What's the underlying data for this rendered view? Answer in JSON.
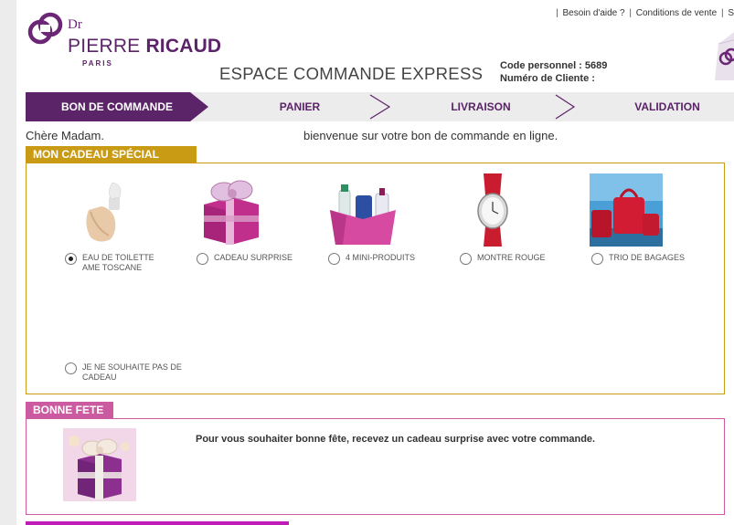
{
  "top_links": {
    "help": "Besoin d'aide ?",
    "terms": "Conditions de vente",
    "more": "S"
  },
  "logo": {
    "dr": "Dr",
    "first": "PIERRE",
    "last": "RICAUD",
    "city": "PARIS"
  },
  "header": {
    "title": "ESPACE COMMANDE EXPRESS",
    "code_label": "Code personnel :",
    "code_value": "5689",
    "client_label": "Numéro de Cliente :",
    "client_value": ""
  },
  "steps": [
    {
      "label": "BON DE COMMANDE",
      "active": true
    },
    {
      "label": "PANIER",
      "active": false
    },
    {
      "label": "LIVRAISON",
      "active": false
    },
    {
      "label": "VALIDATION",
      "active": false
    }
  ],
  "greeting": {
    "salutation": "Chère Madam.",
    "welcome": "bienvenue sur votre bon de commande en ligne."
  },
  "gift_section": {
    "title": "MON CADEAU SPÉCIAL FÊTES",
    "options": [
      {
        "label": "EAU DE TOILETTE AME TOSCANE",
        "selected": true,
        "icon": "perfume-bottle-image"
      },
      {
        "label": "CADEAU SURPRISE",
        "selected": false,
        "icon": "gift-box-image"
      },
      {
        "label": "4 MINI-PRODUITS",
        "selected": false,
        "icon": "mini-products-image"
      },
      {
        "label": "MONTRE ROUGE",
        "selected": false,
        "icon": "red-watch-image"
      },
      {
        "label": "TRIO DE BAGAGES",
        "selected": false,
        "icon": "luggage-trio-image"
      }
    ],
    "no_gift_label": "JE NE SOUHAITE PAS DE CADEAU",
    "no_gift_selected": false
  },
  "fete_section": {
    "title": "BONNE FETE !",
    "message": "Pour vous souhaiter bonne fête, recevez un cadeau surprise avec votre commande."
  },
  "colors": {
    "brand_purple": "#5b2368",
    "gift_gold": "#c99a14",
    "fete_pink": "#cc5aa0"
  }
}
